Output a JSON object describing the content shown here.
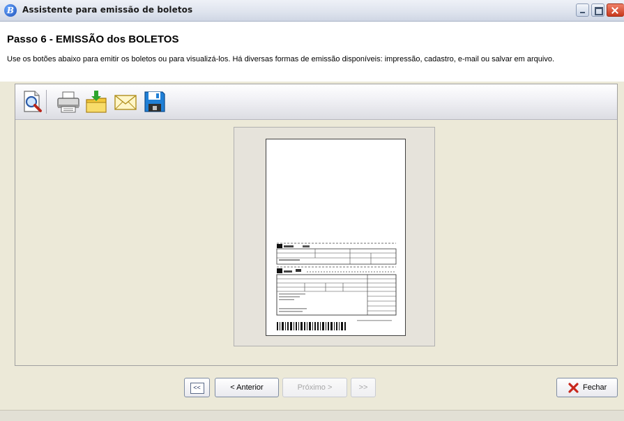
{
  "window": {
    "title": "Assistente para emissão de boletos",
    "app_icon_letter": "B"
  },
  "header": {
    "step_title": "Passo 6 - EMISSÃO dos BOLETOS",
    "description": "Use os botões abaixo para emitir os boletos ou para visualizá-los. Há diversas formas de emissão disponíveis: impressão, cadastro, e-mail ou salvar em arquivo."
  },
  "toolbar": {
    "items": [
      {
        "name": "preview",
        "icon": "magnifier-page-icon"
      },
      {
        "name": "print",
        "icon": "printer-icon"
      },
      {
        "name": "register",
        "icon": "folder-download-icon"
      },
      {
        "name": "email",
        "icon": "envelope-icon"
      },
      {
        "name": "save",
        "icon": "floppy-disk-icon"
      }
    ]
  },
  "nav": {
    "first_label": "<<",
    "prev_label": "< Anterior",
    "next_label": "Próximo >",
    "last_label": ">>",
    "close_label": "Fechar"
  },
  "colors": {
    "accent": "#1c4fb8",
    "close_x": "#c8281d",
    "window_bg": "#ece9d8"
  }
}
